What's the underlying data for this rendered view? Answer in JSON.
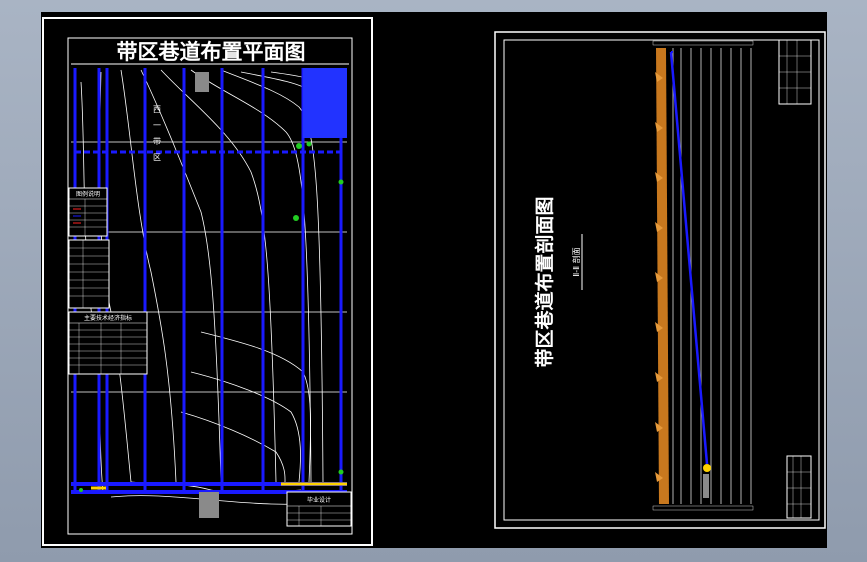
{
  "left_sheet": {
    "title": "带区巷道布置平面图",
    "zone_label": [
      "西",
      "一",
      "带",
      "区"
    ],
    "legend_title": "图例说明",
    "table_title": "主要技术经济指标",
    "stamp_title": "毕业设计"
  },
  "right_sheet": {
    "title": "带区巷道布置剖面图",
    "subtitle": "Ⅱ-Ⅱ 剖面"
  },
  "colors": {
    "background": "#000000",
    "frame": "#ffffff",
    "roadway": "#1a1aff",
    "contour": "#ffffff",
    "coal_seam": "#c8781e",
    "highlight": "#ffd200",
    "marker": "#22cc22",
    "fill_block": "#2233ff"
  }
}
